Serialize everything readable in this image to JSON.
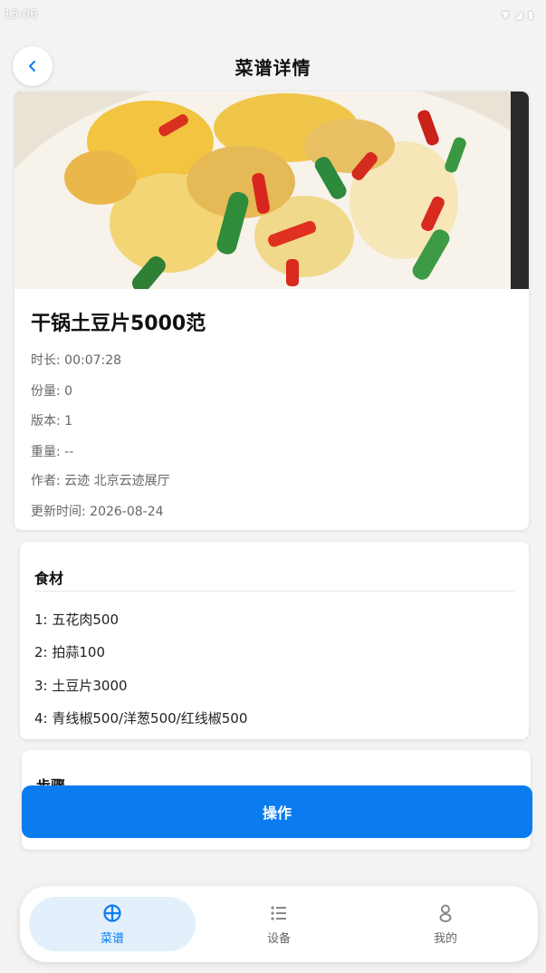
{
  "status_bar": {
    "time": "15:06"
  },
  "header": {
    "title": "菜谱详情"
  },
  "recipe": {
    "name": "干锅土豆片5000范",
    "meta": {
      "duration": "时长: 00:07:28",
      "servings": "份量: 0",
      "version": "版本: 1",
      "weight": "重量: --",
      "author": "作者: 云迹 北京云迹展厅",
      "updated": "更新时间: 2026-08-24"
    }
  },
  "ingredients": {
    "title": "食材",
    "items": [
      "1: 五花肉500",
      "2: 拍蒜100",
      "3: 土豆片3000",
      "4: 青线椒500/洋葱500/红线椒500"
    ]
  },
  "steps": {
    "title": "步骤"
  },
  "action": {
    "label": "操作"
  },
  "nav": {
    "items": [
      {
        "label": "菜谱",
        "icon": "recipe-icon",
        "active": true
      },
      {
        "label": "设备",
        "icon": "list-icon",
        "active": false
      },
      {
        "label": "我的",
        "icon": "user-icon",
        "active": false
      }
    ]
  },
  "colors": {
    "accent": "#0a7cf0",
    "nav_active_bg": "#e3effb",
    "background": "#f3f3f3"
  }
}
